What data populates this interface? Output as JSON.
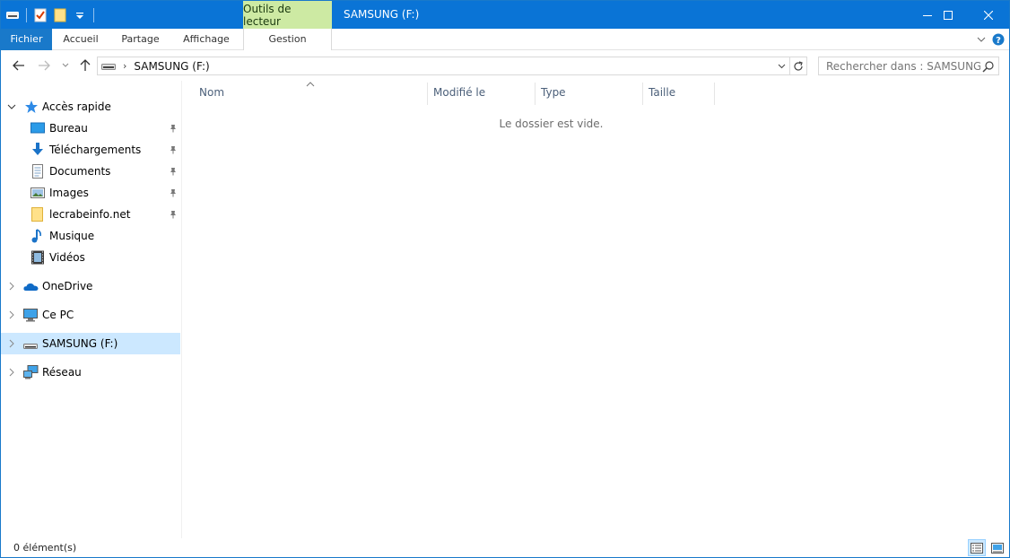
{
  "window": {
    "title": "SAMSUNG (F:)",
    "context_group_label": "Outils de lecteur",
    "controls": {
      "minimize": "minimize-icon",
      "maximize": "maximize-icon",
      "close": "close-icon"
    }
  },
  "ribbon": {
    "tabs": [
      {
        "label": "Fichier"
      },
      {
        "label": "Accueil"
      },
      {
        "label": "Partage"
      },
      {
        "label": "Affichage"
      },
      {
        "label": "Gestion"
      }
    ]
  },
  "address": {
    "path": "SAMSUNG (F:)",
    "search_placeholder": "Rechercher dans : SAMSUNG ..."
  },
  "nav": {
    "quick_access": "Accès rapide",
    "items": [
      {
        "label": "Bureau",
        "pinned": true,
        "icon": "desktop-icon"
      },
      {
        "label": "Téléchargements",
        "pinned": true,
        "icon": "download-icon"
      },
      {
        "label": "Documents",
        "pinned": true,
        "icon": "documents-icon"
      },
      {
        "label": "Images",
        "pinned": true,
        "icon": "pictures-icon"
      },
      {
        "label": "lecrabeinfo.net",
        "pinned": true,
        "icon": "folder-icon"
      },
      {
        "label": "Musique",
        "pinned": false,
        "icon": "music-icon"
      },
      {
        "label": "Vidéos",
        "pinned": false,
        "icon": "videos-icon"
      }
    ],
    "roots": [
      {
        "label": "OneDrive",
        "icon": "onedrive-icon"
      },
      {
        "label": "Ce PC",
        "icon": "computer-icon"
      },
      {
        "label": "SAMSUNG (F:)",
        "icon": "drive-icon",
        "selected": true
      },
      {
        "label": "Réseau",
        "icon": "network-icon"
      }
    ]
  },
  "content": {
    "columns": [
      "Nom",
      "Modifié le",
      "Type",
      "Taille"
    ],
    "empty_message": "Le dossier est vide."
  },
  "status": {
    "item_count": "0 élément(s)"
  },
  "colors": {
    "titlebar": "#0a74d6",
    "file_tab": "#1979ca",
    "context_tab": "#cdeaa3",
    "selection": "#cce8ff"
  }
}
